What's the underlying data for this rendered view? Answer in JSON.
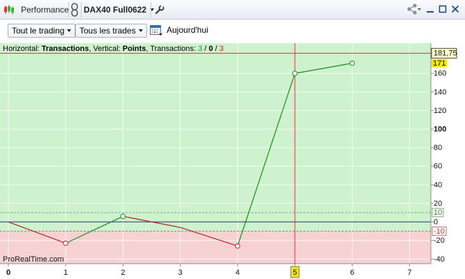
{
  "window": {
    "title": "Performance",
    "instrument": "DAX40 Full0622"
  },
  "toolbar": {
    "dropdown1_label": "Tout le trading",
    "dropdown2_label": "Tous les trades",
    "today_label": "Aujourd'hui"
  },
  "chart_header": {
    "horizontal_label": "Horizontal: ",
    "horizontal_value": "Transactions",
    "vertical_label": ", Vertical: ",
    "vertical_value": "Points",
    "transactions_label": ", Transactions: ",
    "tx_win": "3",
    "tx_sep1": " / ",
    "tx_neutral": "0",
    "tx_sep2": " / ",
    "tx_loss": "3"
  },
  "watermark": "ProRealTime.com",
  "colors": {
    "profit_zone": "#cef2ce",
    "loss_zone": "#f7d2d2",
    "win_line": "#1a8a1a",
    "loss_line": "#b02222",
    "cursor": "#e03030",
    "zero_line": "#1a2a6a",
    "highlight_label": "#f4e21a"
  },
  "chart_data": {
    "type": "line",
    "x": [
      0,
      1,
      2,
      3,
      4,
      5,
      6
    ],
    "y": [
      0,
      -23,
      6,
      -6,
      -26,
      160,
      171
    ],
    "markers_at_x": [
      1,
      2,
      4,
      5,
      6
    ],
    "x_ticks": [
      "0",
      "1",
      "2",
      "3",
      "4",
      "5",
      "6",
      "7"
    ],
    "y_ticks": [
      "-40",
      "-20",
      "0",
      "20",
      "40",
      "60",
      "80",
      "100",
      "120",
      "140",
      "160"
    ],
    "ylim": [
      -45,
      182
    ],
    "xlim": [
      0,
      7.3
    ],
    "threshold_upper": 10,
    "threshold_lower": -10,
    "threshold_upper_label": "10",
    "threshold_lower_label": "-10",
    "cursor_x": 5,
    "cursor_x_label": "5",
    "cursor_y_label": "181,75",
    "last_value_label": "171",
    "bold_tick": "100",
    "grid": true
  }
}
